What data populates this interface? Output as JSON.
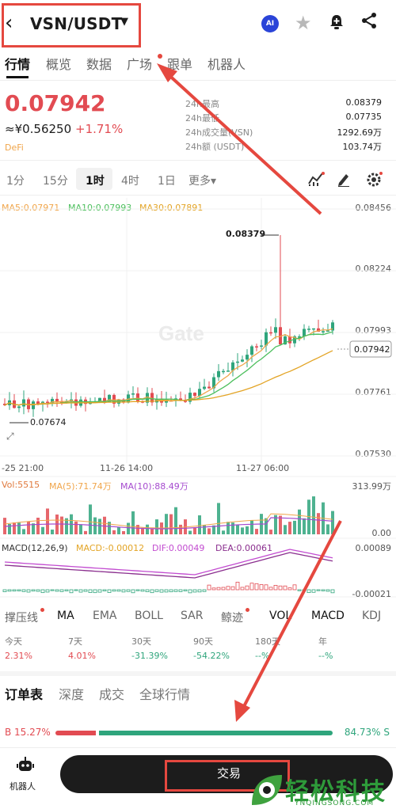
{
  "header": {
    "back_icon": "chevron-left-icon",
    "pair": "VSN/USDT",
    "ai_badge": "AI"
  },
  "tabs": [
    "行情",
    "概览",
    "数据",
    "广场",
    "跟单",
    "机器人"
  ],
  "ticker": {
    "price": "0.07942",
    "cny": "≈¥0.56250",
    "change": "+1.71%",
    "tag": "DeFi",
    "stats": [
      {
        "label": "24h最高",
        "value": "0.08379"
      },
      {
        "label": "24h最低",
        "value": "0.07735"
      },
      {
        "label": "24h成交量(VSN)",
        "value": "1292.69万"
      },
      {
        "label": "24h额 (USDT)",
        "value": "103.74万"
      }
    ]
  },
  "intervals": [
    "1分",
    "15分",
    "1时",
    "4时",
    "1日",
    "更多▾"
  ],
  "ma_legend": {
    "ma5": "MA5:0.07971",
    "ma10": "MA10:0.07993",
    "ma30": "MA30:0.07891"
  },
  "price_axis": [
    "0.08456",
    "0.08224",
    "0.07993",
    "0.07761",
    "0.07530"
  ],
  "time_axis": [
    "-25 21:00",
    "11-26 14:00",
    "11-27 06:00"
  ],
  "annotations": {
    "high": "0.08379",
    "low": "0.07674",
    "last": "0.07942"
  },
  "vol_legend": {
    "vol": "Vol:5515",
    "ma5": "MA(5):71.74万",
    "ma10": "MA(10):88.49万"
  },
  "vol_axis": [
    "313.99万",
    "0.00"
  ],
  "macd_legend": {
    "title": "MACD(12,26,9)",
    "macd": "MACD:-0.00012",
    "dif": "DIF:0.00049",
    "dea": "DEA:0.00061"
  },
  "macd_axis": [
    "0.00089",
    "-0.00021"
  ],
  "indicators": [
    "撑压线",
    "MA",
    "EMA",
    "BOLL",
    "SAR",
    "鲸迹",
    "VOL",
    "MACD",
    "KDJ"
  ],
  "periods": [
    {
      "label": "今天",
      "value": "2.31%"
    },
    {
      "label": "7天",
      "value": "4.01%"
    },
    {
      "label": "30天",
      "value": "-31.39%"
    },
    {
      "label": "90天",
      "value": "-54.22%"
    },
    {
      "label": "180天",
      "value": "--%"
    },
    {
      "label": "年",
      "value": "--%"
    }
  ],
  "orderbook_tabs": [
    "订单表",
    "深度",
    "成交",
    "全球行情"
  ],
  "ratio": {
    "buy": "B 15.27%",
    "sell": "84.73% S",
    "buy_fraction": 0.1527
  },
  "bottom": {
    "robot_label": "机器人",
    "trade_label": "交易"
  },
  "watermark": {
    "brand": "轻松科技",
    "domain": "YNQINGSONG.COM"
  },
  "colors": {
    "up": "#2fa57c",
    "down": "#e24b52",
    "ma5": "#f0a54a",
    "ma10": "#4cbf5d",
    "ma30": "#e3a425",
    "accent_red": "#e5483f"
  }
}
